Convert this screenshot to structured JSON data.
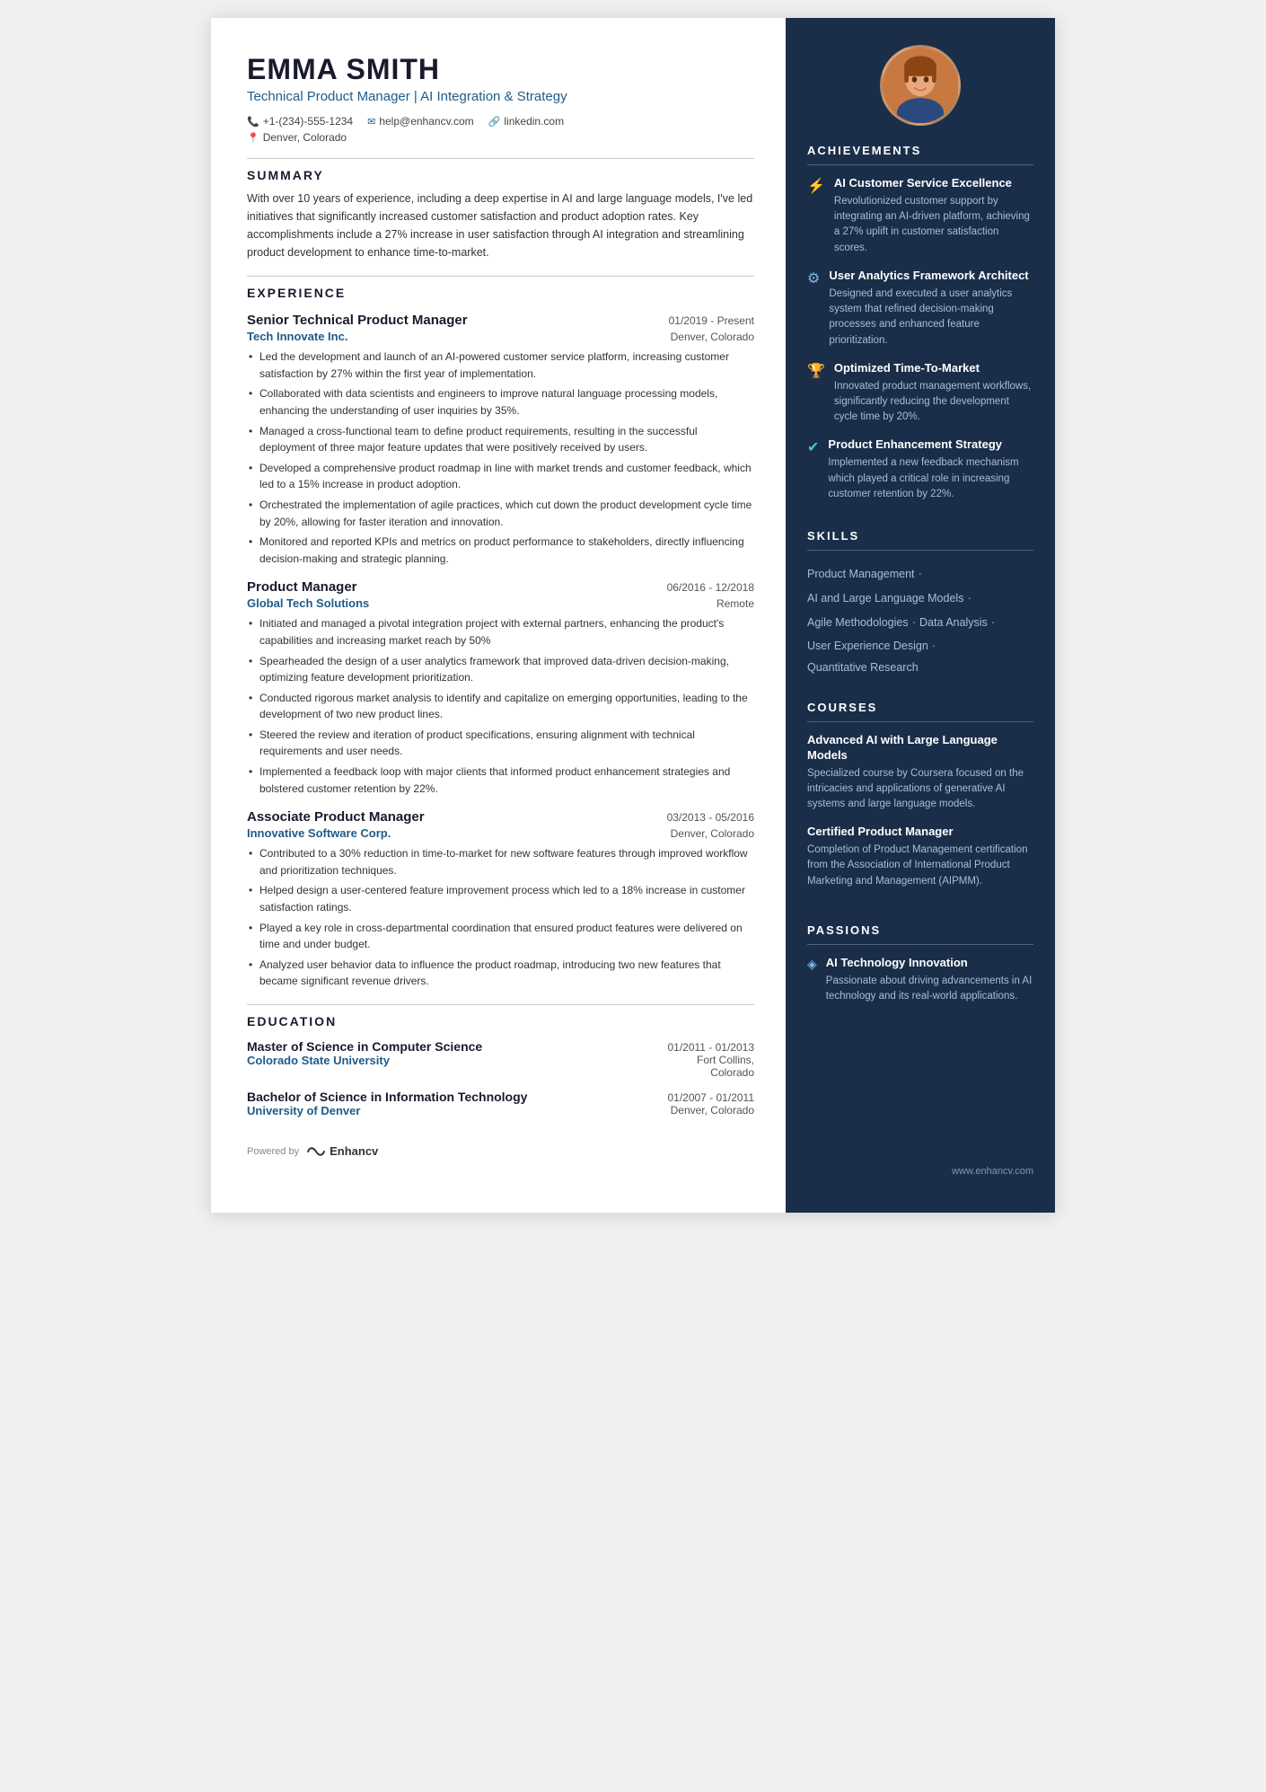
{
  "header": {
    "name": "EMMA SMITH",
    "title": "Technical Product Manager | AI Integration & Strategy",
    "phone": "+1-(234)-555-1234",
    "email": "help@enhancv.com",
    "linkedin": "linkedin.com",
    "location": "Denver, Colorado"
  },
  "summary": {
    "label": "SUMMARY",
    "text": "With over 10 years of experience, including a deep expertise in AI and large language models, I've led initiatives that significantly increased customer satisfaction and product adoption rates. Key accomplishments include a 27% increase in user satisfaction through AI integration and streamlining product development to enhance time-to-market."
  },
  "experience": {
    "label": "EXPERIENCE",
    "jobs": [
      {
        "title": "Senior Technical Product Manager",
        "date": "01/2019 - Present",
        "company": "Tech Innovate Inc.",
        "location": "Denver, Colorado",
        "bullets": [
          "Led the development and launch of an AI-powered customer service platform, increasing customer satisfaction by 27% within the first year of implementation.",
          "Collaborated with data scientists and engineers to improve natural language processing models, enhancing the understanding of user inquiries by 35%.",
          "Managed a cross-functional team to define product requirements, resulting in the successful deployment of three major feature updates that were positively received by users.",
          "Developed a comprehensive product roadmap in line with market trends and customer feedback, which led to a 15% increase in product adoption.",
          "Orchestrated the implementation of agile practices, which cut down the product development cycle time by 20%, allowing for faster iteration and innovation.",
          "Monitored and reported KPIs and metrics on product performance to stakeholders, directly influencing decision-making and strategic planning."
        ]
      },
      {
        "title": "Product Manager",
        "date": "06/2016 - 12/2018",
        "company": "Global Tech Solutions",
        "location": "Remote",
        "bullets": [
          "Initiated and managed a pivotal integration project with external partners, enhancing the product's capabilities and increasing market reach by 50%",
          "Spearheaded the design of a user analytics framework that improved data-driven decision-making, optimizing feature development prioritization.",
          "Conducted rigorous market analysis to identify and capitalize on emerging opportunities, leading to the development of two new product lines.",
          "Steered the review and iteration of product specifications, ensuring alignment with technical requirements and user needs.",
          "Implemented a feedback loop with major clients that informed product enhancement strategies and bolstered customer retention by 22%."
        ]
      },
      {
        "title": "Associate Product Manager",
        "date": "03/2013 - 05/2016",
        "company": "Innovative Software Corp.",
        "location": "Denver, Colorado",
        "bullets": [
          "Contributed to a 30% reduction in time-to-market for new software features through improved workflow and prioritization techniques.",
          "Helped design a user-centered feature improvement process which led to a 18% increase in customer satisfaction ratings.",
          "Played a key role in cross-departmental coordination that ensured product features were delivered on time and under budget.",
          "Analyzed user behavior data to influence the product roadmap, introducing two new features that became significant revenue drivers."
        ]
      }
    ]
  },
  "education": {
    "label": "EDUCATION",
    "degrees": [
      {
        "degree": "Master of Science in Computer Science",
        "date": "01/2011 - 01/2013",
        "school": "Colorado State University",
        "location": "Fort Collins, Colorado"
      },
      {
        "degree": "Bachelor of Science in Information Technology",
        "date": "01/2007 - 01/2011",
        "school": "University of Denver",
        "location": "Denver, Colorado"
      }
    ]
  },
  "footer_left": {
    "powered_by": "Powered by",
    "brand": "Enhancv"
  },
  "right": {
    "achievements": {
      "label": "ACHIEVEMENTS",
      "items": [
        {
          "icon": "bolt",
          "title": "AI Customer Service Excellence",
          "desc": "Revolutionized customer support by integrating an AI-driven platform, achieving a 27% uplift in customer satisfaction scores."
        },
        {
          "icon": "gear",
          "title": "User Analytics Framework Architect",
          "desc": "Designed and executed a user analytics system that refined decision-making processes and enhanced feature prioritization."
        },
        {
          "icon": "trophy",
          "title": "Optimized Time-To-Market",
          "desc": "Innovated product management workflows, significantly reducing the development cycle time by 20%."
        },
        {
          "icon": "check",
          "title": "Product Enhancement Strategy",
          "desc": "Implemented a new feedback mechanism which played a critical role in increasing customer retention by 22%."
        }
      ]
    },
    "skills": {
      "label": "SKILLS",
      "items": [
        "Product Management",
        "AI and Large Language Models",
        "Agile Methodologies",
        "Data Analysis",
        "User Experience Design",
        "Quantitative Research"
      ]
    },
    "courses": {
      "label": "COURSES",
      "items": [
        {
          "title": "Advanced AI with Large Language Models",
          "desc": "Specialized course by Coursera focused on the intricacies and applications of generative AI systems and large language models."
        },
        {
          "title": "Certified Product Manager",
          "desc": "Completion of Product Management certification from the Association of International Product Marketing and Management (AIPMM)."
        }
      ]
    },
    "passions": {
      "label": "PASSIONS",
      "items": [
        {
          "icon": "diamond",
          "title": "AI Technology Innovation",
          "desc": "Passionate about driving advancements in AI technology and its real-world applications."
        }
      ]
    }
  },
  "footer_right": {
    "website": "www.enhancv.com"
  }
}
